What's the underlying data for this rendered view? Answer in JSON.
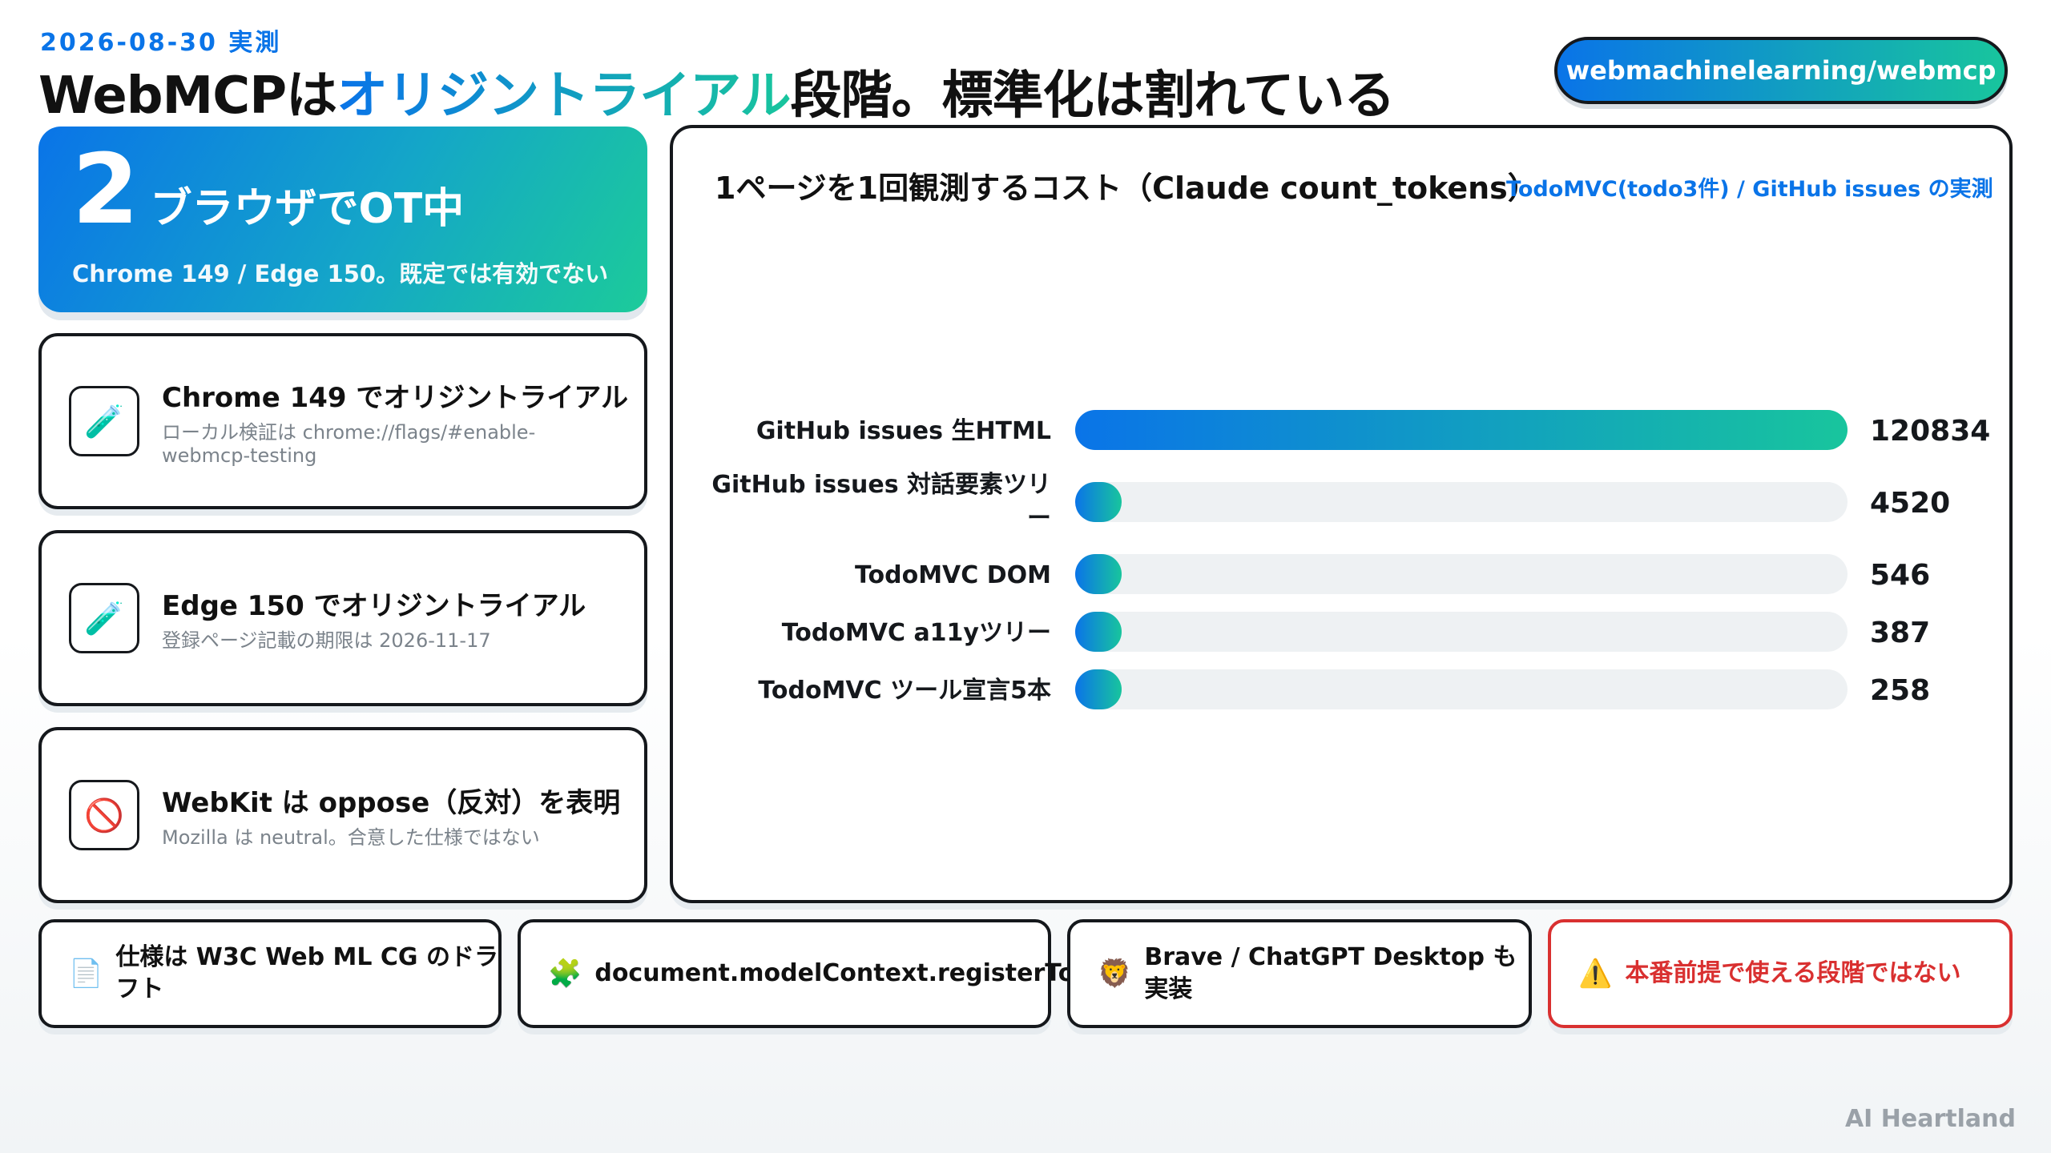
{
  "header": {
    "date": "2026-08-30 実測",
    "title_pre": "WebMCPは",
    "title_highlight": "オリジントライアル",
    "title_post": "段階。標準化は割れている",
    "repo": "webmachinelearning/webmcp"
  },
  "hero": {
    "number": "2",
    "label": "ブラウザでOT中",
    "note": "Chrome 149 / Edge 150。既定では有効でない"
  },
  "cards": [
    {
      "icon": "test-tube-icon",
      "glyph": "🧪",
      "title": "Chrome 149 でオリジントライアル",
      "sub": "ローカル検証は chrome://flags/#enable-webmcp-testing"
    },
    {
      "icon": "test-tube-icon",
      "glyph": "🧪",
      "title": "Edge 150 でオリジントライアル",
      "sub": "登録ページ記載の期限は 2026-11-17"
    },
    {
      "icon": "no-entry-icon",
      "glyph": "🚫",
      "title": "WebKit は oppose（反対）を表明",
      "sub": "Mozilla は neutral。合意した仕様ではない"
    }
  ],
  "panel": {
    "title": "1ページを1回観測するコスト（Claude count_tokens）",
    "note": "TodoMVC(todo3件) / GitHub issues の実測"
  },
  "chart_data": {
    "type": "bar",
    "orientation": "horizontal",
    "categories": [
      "GitHub issues 生HTML",
      "GitHub issues 対話要素ツリー",
      "TodoMVC DOM",
      "TodoMVC a11yツリー",
      "TodoMVC ツール宣言5本"
    ],
    "values": [
      120834,
      4520,
      546,
      387,
      258
    ],
    "value_labels": [
      "120834",
      "4520",
      "546",
      "387",
      "258"
    ],
    "xlim": [
      0,
      120834
    ],
    "grid": false,
    "colors": {
      "bar_start": "#0a74e8",
      "bar_end": "#18c59d",
      "track": "#eef1f3"
    }
  },
  "footer": [
    {
      "icon": "document-icon",
      "glyph": "📄",
      "text": "仕様は W3C Web ML CG のドラフト"
    },
    {
      "icon": "puzzle-icon",
      "glyph": "🧩",
      "text": "document.modelContext.registerTool"
    },
    {
      "icon": "lion-icon",
      "glyph": "🦁",
      "text": "Brave / ChatGPT Desktop も実装"
    },
    {
      "icon": "warning-icon",
      "glyph": "⚠️",
      "text": "本番前提で使える段階ではない"
    }
  ],
  "brand": "AI Heartland"
}
